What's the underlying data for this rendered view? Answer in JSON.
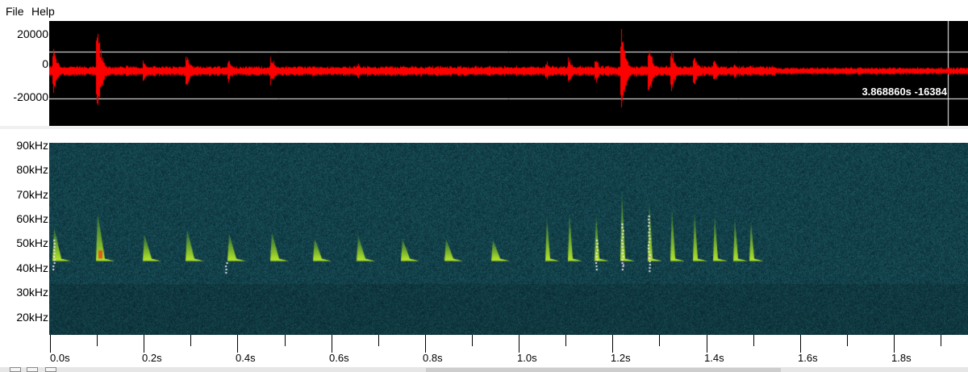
{
  "menu": {
    "file": "File",
    "help": "Help"
  },
  "waveform": {
    "y_labels": [
      "20000",
      "0",
      "-20000"
    ],
    "color": "#ff0000",
    "background": "#000000",
    "cursor_readout": "3.868860s -16384"
  },
  "spectrogram": {
    "y_labels": [
      "90kHz",
      "80kHz",
      "70kHz",
      "60kHz",
      "50kHz",
      "40kHz",
      "30kHz",
      "20kHz"
    ],
    "background": "#0f3d44",
    "call_color": "#7fd21a"
  },
  "time_axis": {
    "labels": [
      "0.0s",
      "0.2s",
      "0.4s",
      "0.6s",
      "0.8s",
      "1.0s",
      "1.2s",
      "1.4s",
      "1.6s",
      "1.8s"
    ]
  }
}
